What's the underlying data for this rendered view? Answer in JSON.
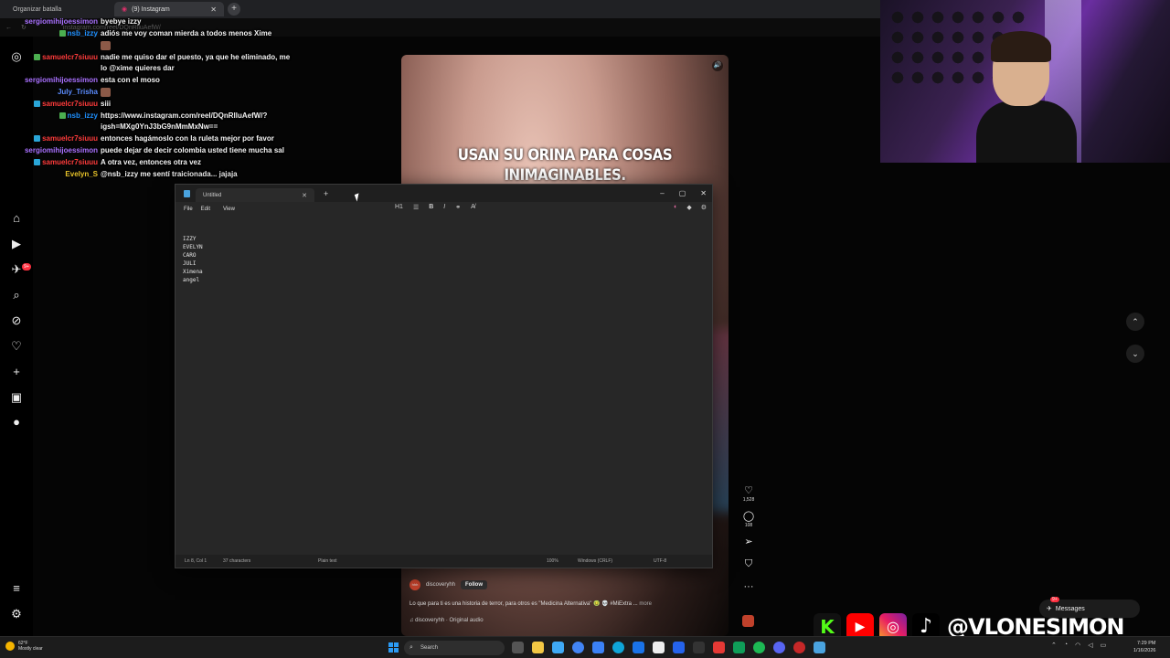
{
  "browser": {
    "tabs": [
      {
        "label": "Organizar batalla"
      },
      {
        "label": "(9) Instagram"
      }
    ],
    "address": "instagram.com/reel/DQnRlluAefW/"
  },
  "chat": [
    {
      "user": "sergiomihijoessimon",
      "color": "#a970ff",
      "badge": "",
      "message": "byebye izzy"
    },
    {
      "user": "nsb_izzy",
      "color": "#1e90ff",
      "badge": "mod",
      "message": "adiós me voy coman mierda a todos menos Xime"
    },
    {
      "user": "",
      "color": "#ffffff",
      "badge": "",
      "message": "",
      "emote": true
    },
    {
      "user": "samuelcr7siuuu",
      "color": "#ff3b3b",
      "badge": "mod",
      "message": "nadie me quiso dar el puesto, ya que he eliminado, me lo @xime quieres dar"
    },
    {
      "user": "sergiomihijoessimon",
      "color": "#a970ff",
      "badge": "",
      "message": "esta con el moso"
    },
    {
      "user": "July_Trisha",
      "color": "#5b8cff",
      "badge": "",
      "message": "",
      "emote": true
    },
    {
      "user": "samuelcr7siuuu",
      "color": "#ff3b3b",
      "badge": "mod",
      "message": "siii"
    },
    {
      "user": "nsb_izzy",
      "color": "#1e90ff",
      "badge": "mod",
      "message": "https://www.instagram.com/reel/DQnRlluAefW/?igsh=MXg0YnJ3bG9nMmMxNw=="
    },
    {
      "user": "samuelcr7siuuu",
      "color": "#ff3b3b",
      "badge": "mod",
      "message": "entonces hagámoslo con la ruleta mejor por favor"
    },
    {
      "user": "sergiomihijoessimon",
      "color": "#a970ff",
      "badge": "",
      "message": "puede dejar de decir colombia usted tiene mucha sal"
    },
    {
      "user": "samuelcr7siuuu",
      "color": "#ff3b3b",
      "badge": "mod",
      "message": "A otra vez, entonces otra vez"
    },
    {
      "user": "Evelyn_S",
      "color": "#e6c229",
      "badge": "",
      "message": "@nsb_izzy me sentí traicionada... jajaja"
    }
  ],
  "chat_top_user": "Evelyn_S",
  "reel": {
    "caption_line1": "USAN SU ORINA PARA COSAS",
    "caption_line2": "INIMAGINABLES.",
    "author": "discoveryhh",
    "author_avatar": "hhh",
    "follow_label": "Follow",
    "description": "Lo que para ti es una historia de terror, para otros es \"Medicina Alternativa\" 🤢 💀 #MiExtra ...",
    "more_label": "more",
    "audio": "♫ discoveryhh · Original audio",
    "likes": "1,528",
    "comments": "108",
    "more_dots": "···"
  },
  "notepad": {
    "tab_title": "Untitled",
    "menus": [
      "File",
      "Edit",
      "View"
    ],
    "heading_label": "H1",
    "lines": [
      "IZZY",
      "EVELYN",
      "CARO",
      "JULI",
      "Ximena",
      "angel"
    ],
    "status": {
      "position": "Ln 8, Col 1",
      "chars": "37 characters",
      "format": "Plain text",
      "zoom": "100%",
      "eol": "Windows (CRLF)",
      "encoding": "UTF-8"
    }
  },
  "messages": {
    "label": "Messages",
    "badge": "9+"
  },
  "rail_badge": "9+",
  "social": {
    "handle": "@VLONESIMON",
    "kick": "K",
    "tiktok": "♪"
  },
  "taskbar": {
    "weather_temp": "62°F",
    "weather_desc": "Mostly clear",
    "search_label": "Search",
    "time": "7:29 PM",
    "date": "1/16/2026"
  },
  "colors": {
    "accent_blue": "#4aa3df",
    "ig_red": "#ff3040",
    "youtube": "#ff0000",
    "kick": "#53fc18"
  }
}
